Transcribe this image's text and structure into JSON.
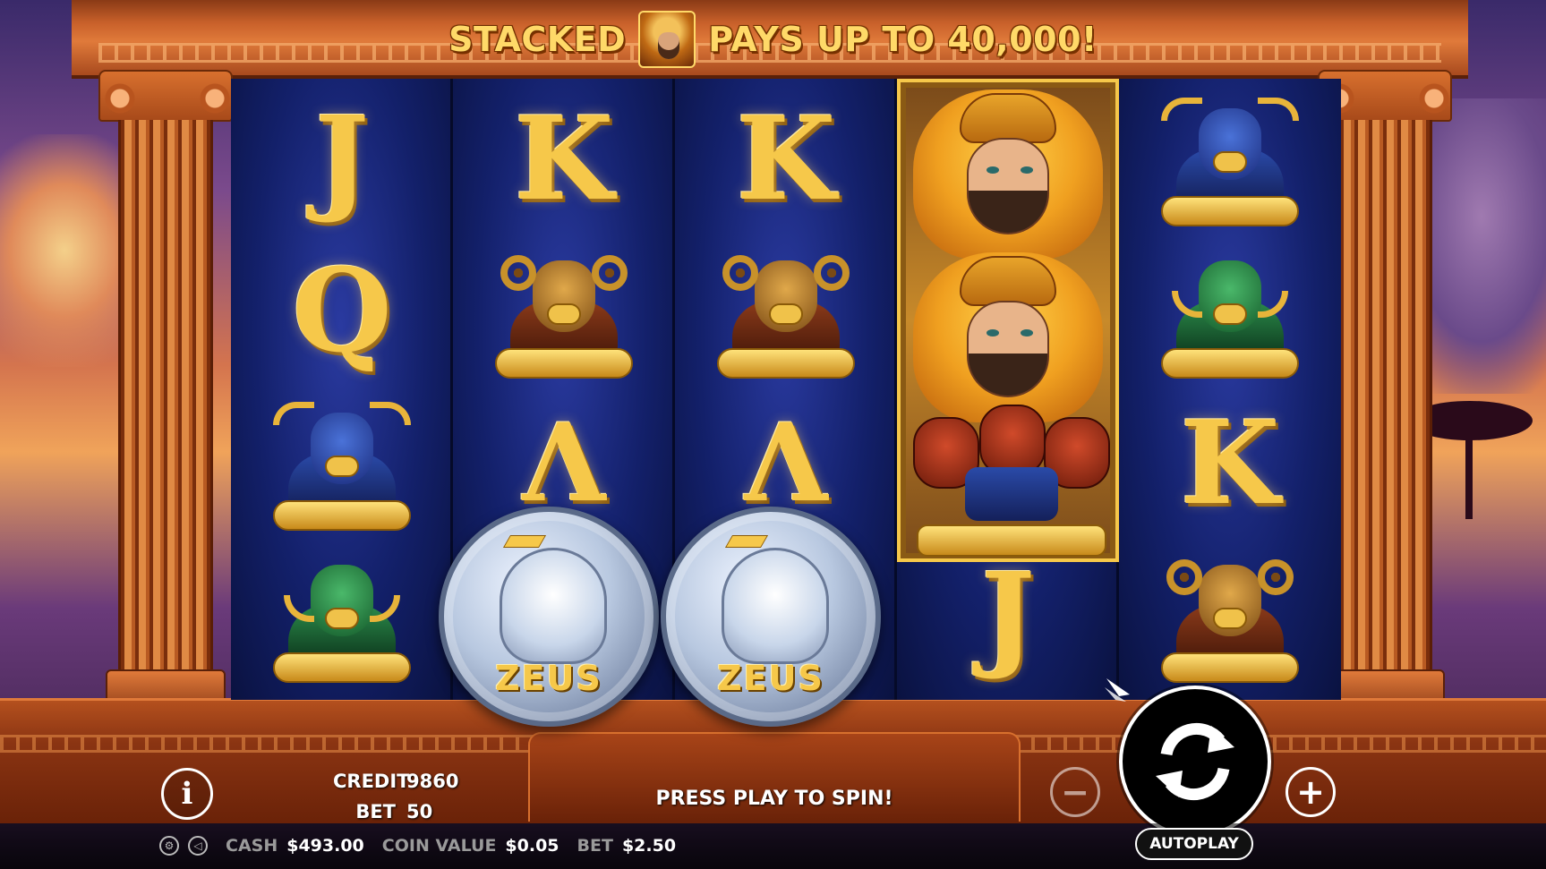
{
  "header": {
    "left_text": "STACKED",
    "right_text": "PAYS UP TO 40,000!"
  },
  "reels": [
    [
      "J",
      "Q",
      "bull",
      "boar"
    ],
    [
      "K",
      "ram",
      "Λ",
      "zeus-coin"
    ],
    [
      "K",
      "ram",
      "Λ",
      "zeus-coin"
    ],
    [
      "hercules",
      "hercules",
      "cerberus",
      "J"
    ],
    [
      "bull",
      "boar",
      "K",
      "ram"
    ]
  ],
  "reel_letters": {
    "r1c0": "J",
    "r1c1": "Q",
    "r2c0": "K",
    "r2c2": "Λ",
    "r3c0": "K",
    "r3c2": "Λ",
    "r4c3": "J",
    "r5c2": "K"
  },
  "coin_label": "ZEUS",
  "hud": {
    "info_label": "i",
    "credit_label": "CREDIT",
    "credit_value": "9860",
    "bet_label": "BET",
    "bet_value": "50",
    "status_message": "PRESS PLAY TO SPIN!",
    "minus_label": "−",
    "plus_label": "+",
    "autoplay_label": "AUTOPLAY"
  },
  "footer": {
    "cash_label": "CASH",
    "cash_value": "$493.00",
    "coin_value_label": "COIN VALUE",
    "coin_value": "$0.05",
    "bet_label": "BET",
    "bet_value": "$2.50"
  },
  "colors": {
    "gold": "#f6c84a",
    "reel_blue": "#13206a",
    "temple_orange": "#c8602a"
  }
}
